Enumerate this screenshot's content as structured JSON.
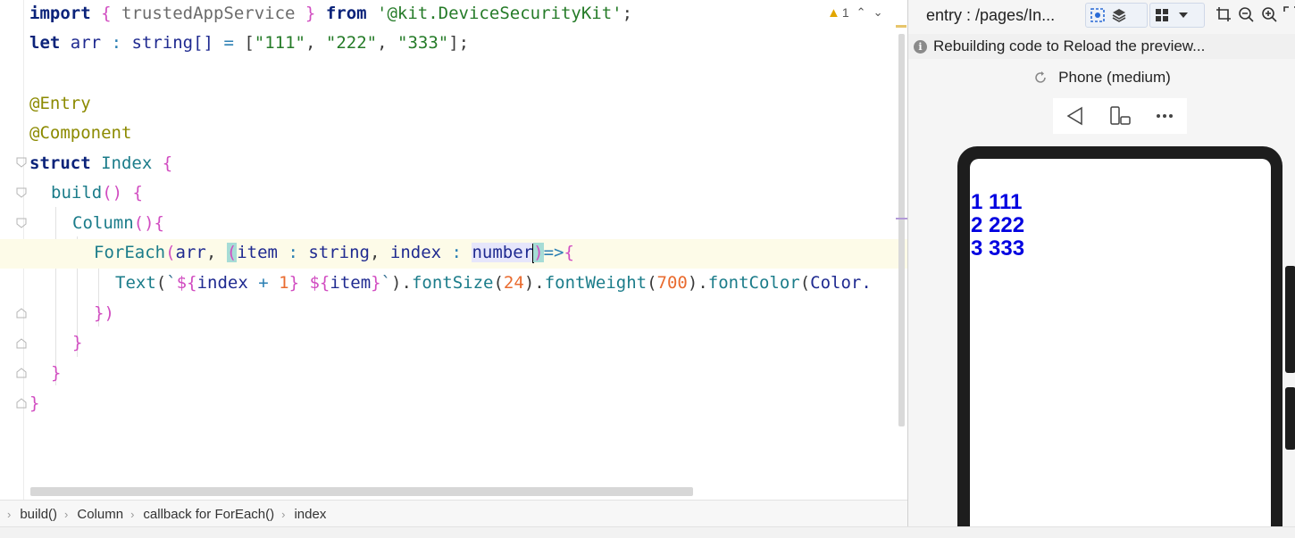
{
  "editor": {
    "warning_count": "1",
    "code": {
      "l1": {
        "import": "import",
        "lb": "{",
        "name": "trustedAppService",
        "rb": "}",
        "from": "from",
        "module": "'@kit.DeviceSecurityKit'",
        "semi": ";"
      },
      "l2": {
        "let": "let",
        "name": "arr",
        "colon": ":",
        "type": "string[]",
        "eq": "=",
        "open": "[",
        "s1": "\"111\"",
        "comma": ",",
        "s2": "\"222\"",
        "s3": "\"333\"",
        "close": "];"
      },
      "l4": {
        "dec": "@Entry"
      },
      "l5": {
        "dec": "@Component"
      },
      "l6": {
        "kw": "struct",
        "name": "Index",
        "brace": "{"
      },
      "l7": {
        "fn": "build",
        "parens": "()",
        "brace": "{"
      },
      "l8": {
        "fn": "Column",
        "parens": "()",
        "brace": "{"
      },
      "l9": {
        "fn": "ForEach",
        "open": "(",
        "arr": "arr",
        "comma": ",",
        "popen": "(",
        "item": "item",
        "colon": ":",
        "type1": "string",
        "index": "index",
        "type2": "numbe",
        "type2_end": "r",
        "pclose": ")",
        "arrow": "=>",
        "brace": "{"
      },
      "l10": {
        "fn": "Text",
        "open": "(",
        "tick": "`",
        "d1": "${",
        "expr1a": "index",
        "plus": "+",
        "one": "1",
        "c1": "}",
        "d2": "${",
        "expr2": "item",
        "c2": "}",
        "close": ")",
        "dot1": ".",
        "m1": "fontSize",
        "a1": "24",
        "m2": "fontWeight",
        "a2": "700",
        "m3": "fontColor",
        "a3": "Color."
      },
      "l11": {
        "text": "})"
      },
      "l12": {
        "text": "}"
      },
      "l13": {
        "text": "}"
      },
      "l14": {
        "text": "}"
      }
    }
  },
  "breadcrumb": [
    "build()",
    "Column",
    "callback for ForEach()",
    "index"
  ],
  "preview": {
    "title": "entry : /pages/In...",
    "status": "Rebuilding code to Reload the preview...",
    "device": "Phone (medium)",
    "rows": [
      "1 111",
      "2 222",
      "3 333"
    ]
  },
  "colors": {
    "preview_text": "#0000e0",
    "current_line": "#fdfbe8",
    "bracket_highlight": "#a6dcd6"
  },
  "icons": {
    "warning": "warning-icon",
    "info": "info-icon",
    "refresh": "refresh-icon",
    "back": "back-triangle-icon",
    "rotate": "rotate-device-icon",
    "more": "more-dots-icon"
  }
}
